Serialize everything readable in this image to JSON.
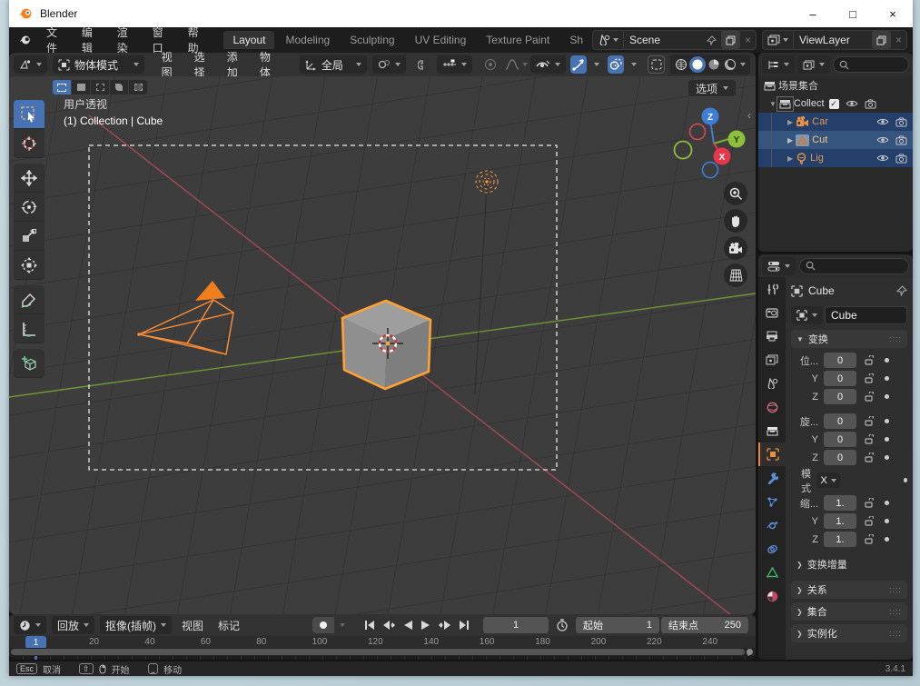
{
  "window": {
    "title": "Blender",
    "minimize": "–",
    "maximize": "□",
    "close": "×"
  },
  "topbar": {
    "menus": [
      "文件",
      "编辑",
      "渲染",
      "窗口",
      "帮助"
    ],
    "workspaces": [
      "Layout",
      "Modeling",
      "Sculpting",
      "UV Editing",
      "Texture Paint",
      "Sh"
    ],
    "scene_value": "Scene",
    "view_layer_value": "ViewLayer"
  },
  "tool_header": {
    "mode_value": "物体模式",
    "menus": [
      "视图",
      "选择",
      "添加",
      "物体"
    ],
    "orientation_value": "全局"
  },
  "viewport": {
    "view_label": "用户透视",
    "context_label": "(1) Collection | Cube",
    "options_label": "选项",
    "axis": {
      "x": "X",
      "y": "Y",
      "z": "Z"
    }
  },
  "outliner": {
    "scene_collection": "场景集合",
    "collection": "Collect",
    "objects": [
      {
        "name": "Car",
        "icon": "camera-icon"
      },
      {
        "name": "Cut",
        "icon": "mesh-icon"
      },
      {
        "name": "Lig",
        "icon": "light-icon"
      }
    ]
  },
  "properties": {
    "active_object": "Cube",
    "id_field": "Cube",
    "transform_title": "变换",
    "location_label": "位...",
    "rotation_label": "旋...",
    "scale_label": "缩...",
    "mode_label": "模式",
    "mode_value": "X",
    "y_label": "Y",
    "z_label": "Z",
    "location": [
      "0",
      "0",
      "0"
    ],
    "rotation": [
      "0",
      "0",
      "0"
    ],
    "scale": [
      "1.",
      "1.",
      "1."
    ],
    "delta_panel": "变换增量",
    "relations_panel": "关系",
    "collections_panel": "集合",
    "instancing_panel": "实例化"
  },
  "timeline": {
    "menus": [
      "回放",
      "抠像(插帧)",
      "视图",
      "标记"
    ],
    "current_frame": "1",
    "start_label": "起始",
    "start_value": "1",
    "end_label": "结束点",
    "end_value": "250",
    "playhead_frame": "1",
    "ticks": [
      "20",
      "40",
      "60",
      "80",
      "100",
      "120",
      "140",
      "160",
      "180",
      "200",
      "220",
      "240"
    ]
  },
  "statusbar": {
    "esc_key": "Esc",
    "cancel_label": "取消",
    "start_label": "开始",
    "move_label": "移动",
    "version": "3.4.1"
  },
  "colors": {
    "accent_blue": "#4772b3",
    "selection_orange": "#ffa133",
    "axis_green": "#76a832",
    "axis_red": "#bc4c5c",
    "outliner_select": "#24406a"
  }
}
